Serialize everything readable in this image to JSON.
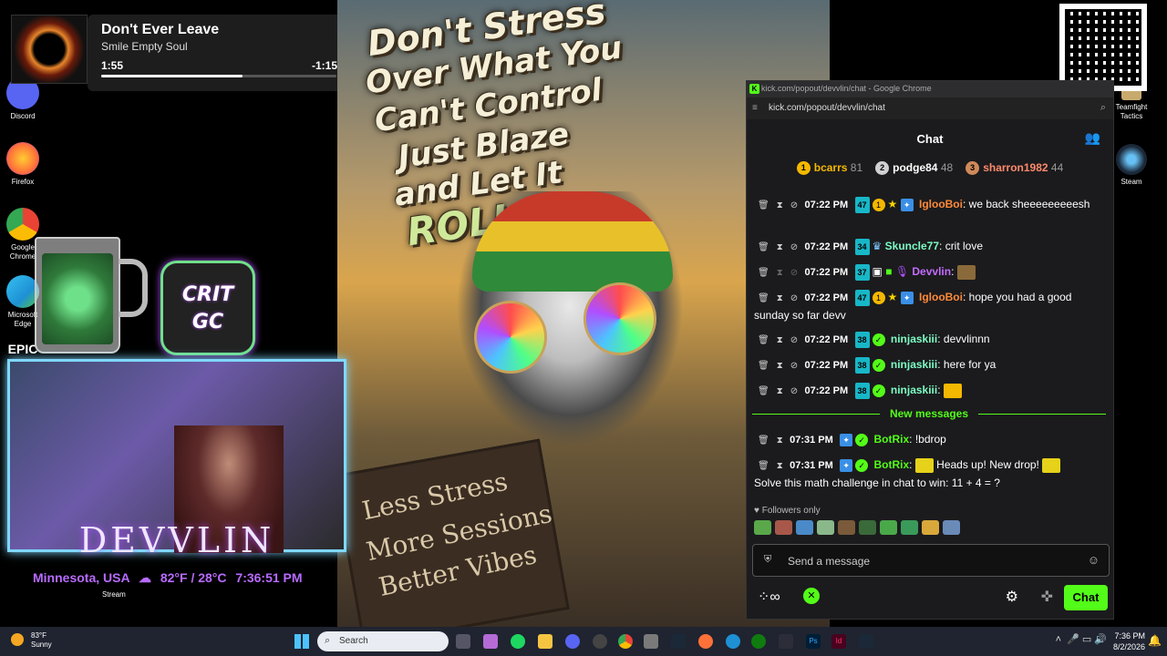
{
  "desktop_left": {
    "icons": [
      {
        "label": "Discord",
        "color": "#5865f2"
      },
      {
        "label": "Firefox",
        "color": "#ff7139"
      },
      {
        "label": "Google Chrome",
        "color": "#4285f4"
      },
      {
        "label": "Microsoft Edge",
        "color": "#1e90d4"
      },
      {
        "label": "EPIC",
        "color": "#222222"
      }
    ]
  },
  "desktop_right": {
    "icons": [
      {
        "label": "Teamfight Tactics",
        "color": "#c8aa6e"
      },
      {
        "label": "Steam",
        "color": "#1b2838"
      }
    ]
  },
  "music": {
    "title": "Don't Ever Leave",
    "artist": "Smile Empty Soul",
    "position": "1:55",
    "remaining": "-1:15",
    "progress": 0.6
  },
  "poster": {
    "headline": [
      "Don't Stress",
      "Over What You",
      "Can't Control",
      "Just Blaze",
      "and Let It",
      "ROLL"
    ],
    "sign": [
      "Less Stress",
      "More Sessions",
      "Better Vibes"
    ]
  },
  "overlay": {
    "logo": [
      "CRIT",
      "GC"
    ],
    "streamer_name": "DEVVLIN",
    "location": "Minnesota, USA",
    "weather": "82°F / 28°C",
    "time": "7:36:51 PM",
    "stream_label": "Stream"
  },
  "browser": {
    "window_title": "kick.com/popout/devvlin/chat - Google Chrome",
    "url": "kick.com/popout/devvlin/chat"
  },
  "chat": {
    "header": "Chat",
    "leaderboard": [
      {
        "rank": "1",
        "user": "bcarrs",
        "points": "81",
        "color": "#f5b800"
      },
      {
        "rank": "2",
        "user": "podge84",
        "points": "48",
        "color": "#d0d0d0"
      },
      {
        "rank": "3",
        "user": "sharron1982",
        "points": "44",
        "color": "#d08a5a"
      }
    ],
    "messages": [
      {
        "time": "07:22 PM",
        "sub": "47",
        "count": "1",
        "user": "IglooBoi",
        "user_color": "#ff8a3a",
        "text": "we back sheeeeeeeeesh"
      },
      {
        "time": "07:22 PM",
        "sub": "34",
        "user": "Skuncle77",
        "user_color": "#7dfcc4",
        "text": "crit love"
      },
      {
        "time": "07:22 PM",
        "sub": "37",
        "user": "Devvlin",
        "user_color": "#c46bff",
        "text": ""
      },
      {
        "time": "07:22 PM",
        "sub": "47",
        "count": "1",
        "user": "IglooBoi",
        "user_color": "#ff8a3a",
        "text": "hope you had a good sunday so far devv"
      },
      {
        "time": "07:22 PM",
        "sub": "38",
        "user": "ninjaskiii",
        "user_color": "#7dfcc4",
        "text": "devvlinnn"
      },
      {
        "time": "07:22 PM",
        "sub": "38",
        "user": "ninjaskiii",
        "user_color": "#7dfcc4",
        "text": "here for ya"
      },
      {
        "time": "07:22 PM",
        "sub": "38",
        "user": "ninjaskiii",
        "user_color": "#7dfcc4",
        "text": ""
      }
    ],
    "new_messages_label": "New messages",
    "new_messages": [
      {
        "time": "07:31 PM",
        "user": "BotRix",
        "user_color": "#53fc18",
        "text": "!bdrop"
      },
      {
        "time": "07:31 PM",
        "user": "BotRix",
        "user_color": "#53fc18",
        "text": "Heads up! New drop!",
        "text2": "Solve this math challenge in chat to win: 11 + 4 = ?"
      }
    ],
    "followers_only": "Followers only",
    "input_placeholder": "Send a message",
    "send_label": "Chat"
  },
  "taskbar": {
    "weather_temp": "83°F",
    "weather_cond": "Sunny",
    "search_placeholder": "Search",
    "clock_time": "7:36 PM",
    "clock_date": "8/2/2026"
  }
}
